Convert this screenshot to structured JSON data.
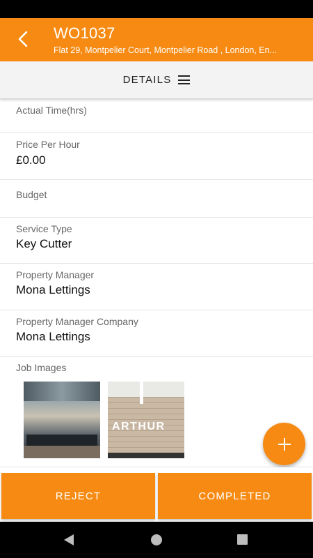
{
  "header": {
    "title": "WO1037",
    "subtitle": "Flat 29, Montpelier Court, Montpelier Road , London, En..."
  },
  "details_bar": {
    "label": "DETAILS"
  },
  "fields": [
    {
      "label": "Actual Time(hrs)",
      "value": ""
    },
    {
      "label": "Price Per Hour",
      "value": "£0.00"
    },
    {
      "label": "Budget",
      "value": ""
    },
    {
      "label": "Service Type",
      "value": "Key Cutter"
    },
    {
      "label": "Property Manager",
      "value": "Mona Lettings"
    },
    {
      "label": "Property Manager Company",
      "value": "Mona Lettings"
    }
  ],
  "job_images": {
    "label": "Job Images",
    "images": [
      {
        "description": "office interior"
      },
      {
        "logo_text": "ARTHUR"
      }
    ]
  },
  "actions": {
    "reject": "REJECT",
    "completed": "COMPLETED"
  },
  "colors": {
    "accent": "#f68a12"
  },
  "icons": {
    "back": "back-arrow-icon",
    "menu": "menu-icon",
    "add": "plus-icon"
  }
}
